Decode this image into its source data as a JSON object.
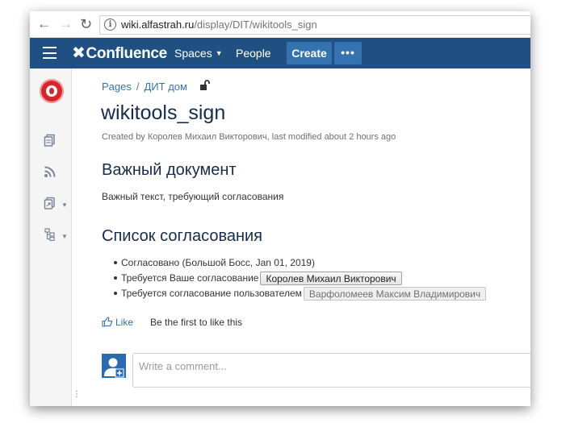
{
  "browser": {
    "url_host": "wiki.alfastrah.ru",
    "url_path": "/display/DIT/wikitools_sign",
    "icons": [
      "back-arrow-icon",
      "forward-arrow-icon",
      "reload-icon",
      "info-icon"
    ]
  },
  "header": {
    "logo": "Confluence",
    "spaces": "Spaces",
    "people": "People",
    "create": "Create",
    "more": "•••",
    "bg_color": "#205081",
    "button_color": "#3572b0"
  },
  "sidebar": {
    "icons": [
      "space-logo-icon",
      "pages-icon",
      "rss-feed-icon",
      "shortcuts-icon",
      "page-tree-icon"
    ]
  },
  "breadcrumb": {
    "pages": "Pages",
    "sep": "/",
    "space": "ДИТ дом"
  },
  "page": {
    "title": "wikitools_sign",
    "byline": "Created by Королев Михаил Викторович, last modified about 2 hours ago",
    "heading1": "Важный документ",
    "paragraph": "Важный текст, требующий согласования",
    "heading2": "Список согласования"
  },
  "approvals": [
    {
      "text": "Согласовано (Большой Босс, Jan 01, 2019)",
      "button": ""
    },
    {
      "text": "Требуется Ваше согласование",
      "button": "Королев Михаил Викторович"
    },
    {
      "text": "Требуется согласование пользователем",
      "button": "Варфоломеев Максим Владимирович"
    }
  ],
  "like": {
    "label": "Like",
    "text": "Be the first to like this"
  },
  "comment": {
    "placeholder": "Write a comment..."
  }
}
